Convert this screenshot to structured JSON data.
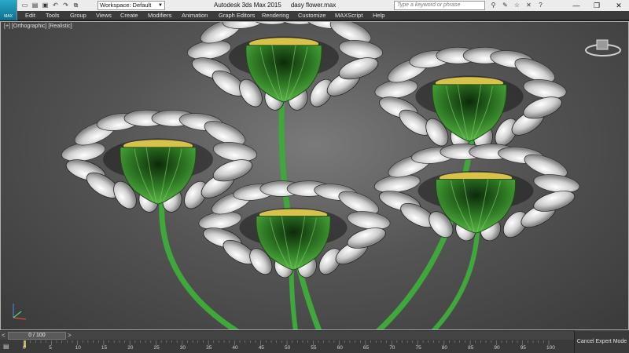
{
  "titlebar": {
    "app_logo": "MAX",
    "workspace": "Workspace: Default",
    "app_title": "Autodesk 3ds Max  2015",
    "file_name": "dasy flower.max",
    "search_placeholder": "Type a keyword or phrase",
    "quick_access_icons": [
      "new-icon",
      "open-icon",
      "save-icon",
      "undo-icon",
      "redo-icon",
      "project-icon"
    ],
    "help_icons": [
      "binoculars-icon",
      "favorites-icon",
      "star-icon",
      "close-search-icon",
      "help-icon"
    ]
  },
  "menu": {
    "items": [
      "Edit",
      "Tools",
      "Group",
      "Views",
      "Create",
      "Modifiers",
      "Animation",
      "Graph Editors",
      "Rendering",
      "Customize",
      "MAXScript",
      "Help"
    ]
  },
  "viewport": {
    "label_plus": "[+]",
    "label_view": "[Orthographic]",
    "label_shading": "[Realistic]"
  },
  "timeline": {
    "slider": "0 / 100",
    "frame_labels": [
      "0",
      "5",
      "10",
      "15",
      "20",
      "25",
      "30",
      "35",
      "40",
      "45",
      "50",
      "55",
      "60",
      "65",
      "70",
      "75",
      "80",
      "85",
      "90",
      "95",
      "100"
    ]
  },
  "status": {
    "cancel_expert": "Cancel Expert Mode"
  },
  "colors": {
    "stem": "#3fa83a",
    "sepal": "#3d9a2f",
    "petal": "#d6d6d6",
    "center": "#d9c24a"
  }
}
